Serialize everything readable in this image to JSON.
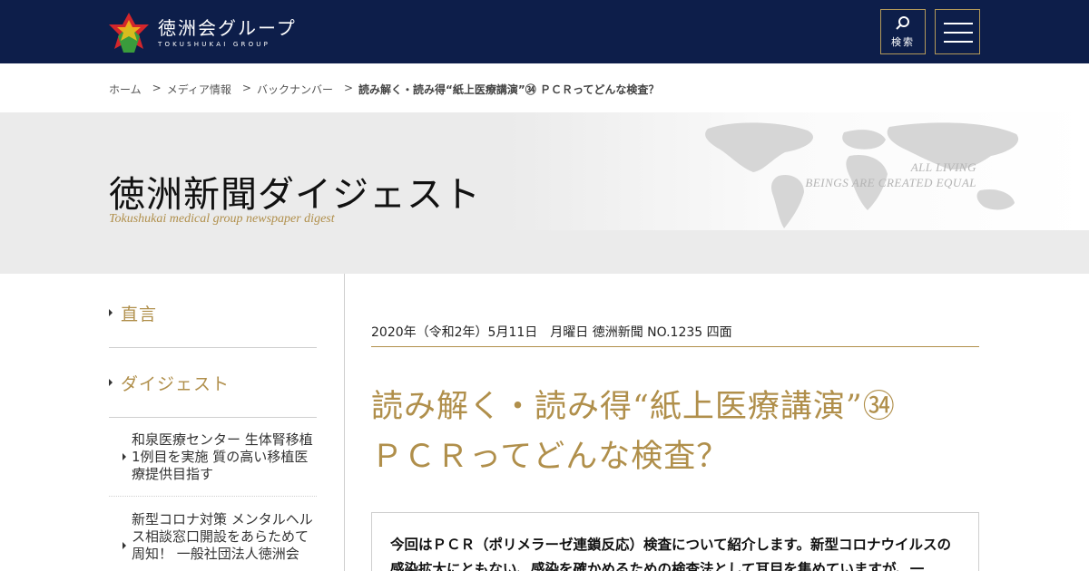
{
  "header": {
    "logo_jp": "徳洲会グループ",
    "logo_en": "TOKUSHUKAI GROUP",
    "search_label": "検索",
    "bg_color": "#0d1e4a",
    "accent_color": "#b49a5a"
  },
  "breadcrumb": {
    "items": [
      "ホーム",
      "メディア情報",
      "バックナンバー"
    ],
    "current": "読み解く・読み得“紙上医療講演”㉞ ＰＣＲってどんな検査？",
    "separator": ">"
  },
  "hero": {
    "title": "徳洲新聞ダイジェスト",
    "subtitle": "Tokushukai medical group newspaper digest",
    "tagline_1": "ALL LIVING",
    "tagline_2": "BEINGS ARE CREATED EQUAL"
  },
  "sidebar": {
    "sections": [
      "直言",
      "ダイジェスト"
    ],
    "items": [
      "和泉医療センター 生体腎移植1例目を実施 質の高い移植医療提供目指す",
      "新型コロナ対策 メンタルヘルス相談窓口開設をあらためて周知！ 一般社団法人徳洲会"
    ]
  },
  "article": {
    "meta": "2020年（令和2年）5月11日　月曜日 徳洲新聞 NO.1235 四面",
    "title_line1": "読み解く・読み得“紙上医療講演”㉞",
    "title_line2": "ＰＣＲってどんな検査？",
    "lead": "今回はＰＣＲ（ポリメラーゼ連鎖反応）検査について紹介します。新型コロナウイルスの感染拡大にともない、感染を確かめるための検査法として耳目を集めていますが、一",
    "accent_color": "#b08f4b"
  }
}
